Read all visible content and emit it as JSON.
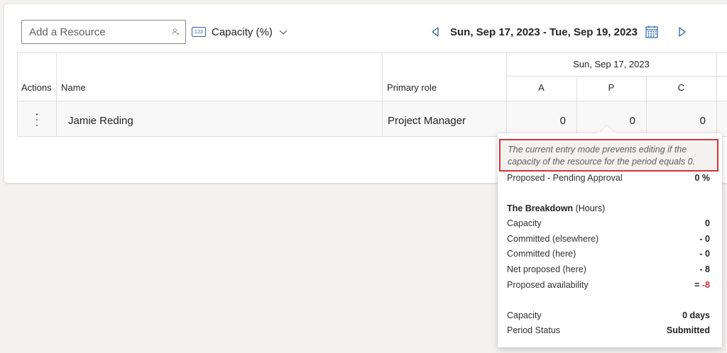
{
  "toolbar": {
    "add_resource_placeholder": "Add a Resource",
    "capacity_label": "Capacity (%)",
    "capacity_icon_text": "123",
    "date_range": "Sun, Sep 17, 2023 - Tue, Sep 19, 2023"
  },
  "table": {
    "headers": {
      "actions": "Actions",
      "name": "Name",
      "primary_role": "Primary role",
      "date_group": "Sun, Sep 17, 2023",
      "shifts": [
        "A",
        "P",
        "C"
      ]
    },
    "rows": [
      {
        "name": "Jamie Reding",
        "primary_role": "Project Manager",
        "values": [
          "0",
          "0",
          "0"
        ]
      }
    ]
  },
  "tooltip": {
    "warning": "The current entry mode prevents editing if the capacity of the resource for the period equals 0.",
    "proposed_label": "Proposed - Pending Approval",
    "proposed_value": "0 %",
    "breakdown_title": "The Breakdown",
    "breakdown_unit": "(Hours)",
    "breakdown": [
      {
        "label": "Capacity",
        "prefix": "",
        "value": "0"
      },
      {
        "label": "Committed (elsewhere)",
        "prefix": "",
        "value": "- 0"
      },
      {
        "label": "Committed (here)",
        "prefix": "",
        "value": "- 0"
      },
      {
        "label": "Net proposed (here)",
        "prefix": "",
        "value": "- 8"
      },
      {
        "label": "Proposed availability",
        "prefix": "= ",
        "value": "-8"
      }
    ],
    "capacity_label": "Capacity",
    "capacity_value": "0 days",
    "period_status_label": "Period Status",
    "period_status_value": "Submitted"
  },
  "colors": {
    "accent": "#2a63ad",
    "warning_border": "#d13438",
    "negative": "#d13438"
  }
}
